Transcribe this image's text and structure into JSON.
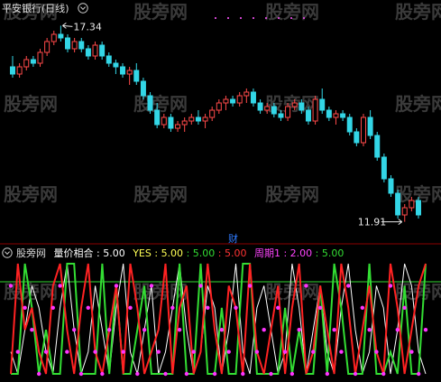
{
  "watermark": "股旁网",
  "top_panel": {
    "title": "平安银行(日线)",
    "title_color": "#d8d8d8",
    "high_label": "17.34",
    "low_label": "11.91",
    "finance_marker": "财",
    "finance_color": "#2f7bff",
    "up_color": "#ff4a4a",
    "down_color": "#33d6e6",
    "dotted_line_color": "#cc44cc",
    "chevron_icon": "circle-chevron-down"
  },
  "bottom_panel": {
    "indicator_name": "股旁网",
    "indicator_name_color": "#d8d8d8",
    "label1": "量价相合",
    "value1": "5.00",
    "label1_color": "#ffffff",
    "label2": "YES",
    "value2a": "5.00",
    "value2b": "5.00",
    "value2c": "5.00",
    "label2_color": "#ffff55",
    "value2a_color": "#ffff55",
    "value2b_color": "#33dd33",
    "value2c_color": "#ff3333",
    "label3": "周期1",
    "value3": "2.00",
    "value3b": "5.00",
    "label3_color": "#ff44ff",
    "value3b_color": "#33dd33",
    "line_green": "#33dd33",
    "line_red": "#ff2222",
    "line_white": "#ffffff",
    "dot_magenta": "#ff33ff"
  },
  "chart_data": [
    {
      "type": "candlestick",
      "title": "平安银行(日线)",
      "annotations": [
        {
          "text": "17.34",
          "kind": "high"
        },
        {
          "text": "11.91",
          "kind": "low"
        },
        {
          "text": "财",
          "kind": "finance-marker"
        }
      ],
      "ylim": [
        11.5,
        17.6
      ],
      "series": [
        {
          "name": "candles",
          "ohlc": [
            [
              16.2,
              16.5,
              15.9,
              16.0
            ],
            [
              16.0,
              16.3,
              15.9,
              16.2
            ],
            [
              16.2,
              16.5,
              16.1,
              16.4
            ],
            [
              16.4,
              16.5,
              16.2,
              16.3
            ],
            [
              16.3,
              16.7,
              16.2,
              16.6
            ],
            [
              16.6,
              17.0,
              16.5,
              16.9
            ],
            [
              16.9,
              17.2,
              16.8,
              17.1
            ],
            [
              17.1,
              17.34,
              16.9,
              17.0
            ],
            [
              17.0,
              17.1,
              16.6,
              16.7
            ],
            [
              16.7,
              17.0,
              16.6,
              16.9
            ],
            [
              16.9,
              17.0,
              16.6,
              16.7
            ],
            [
              16.7,
              16.8,
              16.4,
              16.5
            ],
            [
              16.5,
              16.9,
              16.4,
              16.8
            ],
            [
              16.8,
              16.9,
              16.4,
              16.5
            ],
            [
              16.5,
              16.6,
              16.2,
              16.3
            ],
            [
              16.3,
              16.4,
              16.0,
              16.2
            ],
            [
              16.2,
              16.3,
              15.9,
              16.0
            ],
            [
              16.0,
              16.2,
              15.7,
              16.1
            ],
            [
              16.1,
              16.3,
              15.7,
              15.8
            ],
            [
              15.8,
              15.9,
              15.3,
              15.4
            ],
            [
              15.4,
              15.5,
              14.9,
              15.0
            ],
            [
              15.0,
              15.2,
              14.5,
              14.6
            ],
            [
              14.6,
              14.9,
              14.5,
              14.8
            ],
            [
              14.8,
              14.9,
              14.4,
              14.5
            ],
            [
              14.5,
              14.7,
              14.4,
              14.6
            ],
            [
              14.6,
              14.8,
              14.4,
              14.7
            ],
            [
              14.7,
              14.9,
              14.6,
              14.8
            ],
            [
              14.8,
              15.0,
              14.6,
              14.7
            ],
            [
              14.7,
              14.9,
              14.5,
              14.8
            ],
            [
              14.8,
              15.1,
              14.7,
              15.0
            ],
            [
              15.0,
              15.3,
              14.9,
              15.2
            ],
            [
              15.2,
              15.4,
              15.0,
              15.3
            ],
            [
              15.3,
              15.4,
              15.1,
              15.2
            ],
            [
              15.2,
              15.5,
              15.1,
              15.4
            ],
            [
              15.4,
              15.6,
              15.2,
              15.5
            ],
            [
              15.5,
              15.6,
              15.1,
              15.2
            ],
            [
              15.2,
              15.3,
              14.9,
              15.0
            ],
            [
              15.0,
              15.2,
              14.9,
              15.1
            ],
            [
              15.1,
              15.2,
              14.8,
              14.9
            ],
            [
              14.9,
              15.0,
              14.7,
              14.8
            ],
            [
              14.8,
              15.2,
              14.7,
              15.1
            ],
            [
              15.1,
              15.3,
              15.0,
              15.2
            ],
            [
              15.2,
              15.3,
              14.9,
              15.0
            ],
            [
              15.0,
              15.1,
              14.6,
              14.7
            ],
            [
              14.7,
              15.4,
              14.6,
              15.3
            ],
            [
              15.3,
              15.6,
              14.9,
              15.0
            ],
            [
              15.0,
              15.1,
              14.7,
              14.8
            ],
            [
              14.8,
              15.0,
              14.6,
              14.9
            ],
            [
              14.9,
              15.0,
              14.7,
              14.8
            ],
            [
              14.8,
              14.9,
              14.3,
              14.4
            ],
            [
              14.4,
              14.5,
              14.0,
              14.1
            ],
            [
              14.1,
              14.9,
              14.0,
              14.8
            ],
            [
              14.8,
              15.0,
              14.2,
              14.3
            ],
            [
              14.3,
              14.4,
              13.6,
              13.7
            ],
            [
              13.7,
              13.8,
              13.0,
              13.1
            ],
            [
              13.1,
              13.2,
              12.6,
              12.7
            ],
            [
              12.7,
              12.8,
              12.0,
              12.1
            ],
            [
              12.1,
              12.4,
              11.91,
              12.3
            ],
            [
              12.3,
              12.6,
              12.2,
              12.5
            ],
            [
              12.5,
              12.6,
              12.0,
              12.1
            ]
          ]
        }
      ]
    },
    {
      "type": "line",
      "title": "量价相合",
      "ylim": [
        0,
        5
      ],
      "series": [
        {
          "name": "YES",
          "values": [
            0,
            0,
            5,
            3,
            0,
            2,
            0,
            0,
            5,
            5,
            0,
            0,
            0,
            5,
            0,
            4,
            0,
            0,
            2,
            4,
            0,
            0,
            0,
            0,
            5,
            0,
            0,
            5,
            0,
            0,
            3,
            0,
            0,
            5,
            5,
            0,
            0,
            0,
            0,
            3,
            0,
            2,
            0,
            0,
            4,
            0,
            5,
            3,
            0,
            0,
            0,
            5,
            0,
            0,
            1,
            0,
            4,
            0,
            0,
            5
          ]
        },
        {
          "name": "周期1",
          "values": [
            0,
            5,
            2,
            3,
            1,
            0,
            4,
            5,
            2,
            0,
            3,
            5,
            1,
            0,
            2,
            4,
            0,
            5,
            3,
            0,
            1,
            2,
            5,
            0,
            3,
            4,
            0,
            1,
            5,
            2,
            0,
            4,
            3,
            0,
            5,
            1,
            0,
            2,
            4,
            0,
            3,
            5,
            0,
            1,
            4,
            2,
            0,
            5,
            3,
            0,
            2,
            4,
            1,
            0,
            5,
            3,
            0,
            2,
            4,
            5
          ]
        },
        {
          "name": "white",
          "values": [
            1,
            0,
            2,
            4,
            3,
            1,
            0,
            3,
            5,
            2,
            0,
            1,
            4,
            2,
            0,
            3,
            5,
            1,
            0,
            2,
            4,
            0,
            1,
            3,
            5,
            2,
            0,
            1,
            4,
            3,
            0,
            2,
            5,
            1,
            0,
            3,
            4,
            2,
            0,
            1,
            5,
            3,
            0,
            2,
            4,
            1,
            0,
            3,
            5,
            2,
            0,
            1,
            4,
            3,
            0,
            2,
            5,
            4,
            1,
            0
          ]
        }
      ],
      "points_magenta": [
        4,
        1,
        3,
        2,
        0,
        1,
        3,
        4,
        1,
        2,
        0,
        3,
        1,
        0,
        2,
        4,
        1,
        3,
        0,
        2,
        4,
        1,
        0,
        3,
        2,
        0,
        1,
        4,
        3,
        0,
        2,
        1,
        3,
        0,
        4,
        1,
        2,
        0,
        3,
        1,
        0,
        2,
        4,
        1,
        3,
        0,
        2,
        1,
        4,
        0,
        3,
        2,
        1,
        0,
        4,
        2,
        3,
        1,
        0,
        2
      ]
    }
  ]
}
